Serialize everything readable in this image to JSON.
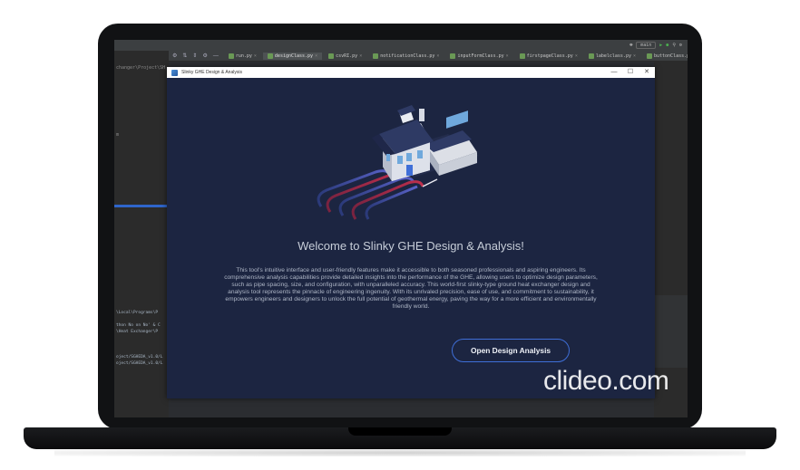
{
  "ide": {
    "run_config": "main",
    "tabs": [
      {
        "label": "run.py",
        "active": false
      },
      {
        "label": "designClass.py",
        "active": true
      },
      {
        "label": "csvRI.py",
        "active": false
      },
      {
        "label": "notificationClass.py",
        "active": false
      },
      {
        "label": "inputFormClass.py",
        "active": false
      },
      {
        "label": "firstpageClass.py",
        "active": false
      },
      {
        "label": "labelclass.py",
        "active": false
      },
      {
        "label": "buttonClass.py",
        "active": false
      }
    ],
    "project_path": "changer\\Project\\SH",
    "console_lines": [
      "\\Local\\Programs\\P",
      "",
      "thon No on No' & C",
      "\\Heat Exchanger\\P",
      "",
      "",
      "",
      "oject/SGHEDA_v1.0/L",
      "oject/SGHEDA_v1.0/L"
    ]
  },
  "app": {
    "window_title": "Slinky GHE Design & Analysis",
    "welcome_heading": "Welcome to Slinky GHE Design & Analysis!",
    "description": "This tool's intuitive interface and user-friendly features make it accessible to both seasoned professionals and aspiring engineers. Its comprehensive analysis capabilities provide detailed insights into the performance of the GHE, allowing users to optimize design parameters, such as pipe spacing, size, and configuration, with unparalleled accuracy. This world-first slinky-type ground heat exchanger design and analysis tool represents the pinnacle of engineering ingenuity. With its unrivaled precision, ease of use, and commitment to sustainability, it empowers engineers and designers to unlock the full potential of geothermal energy, paving the way for a more efficient and environmentally friendly world.",
    "open_button_label": "Open Design  Analysis",
    "accent_color": "#3f6fd8",
    "background_color": "#1c2541"
  },
  "watermark": "clideo.com",
  "icons": {
    "minimize": "—",
    "maximize": "☐",
    "close": "✕"
  }
}
